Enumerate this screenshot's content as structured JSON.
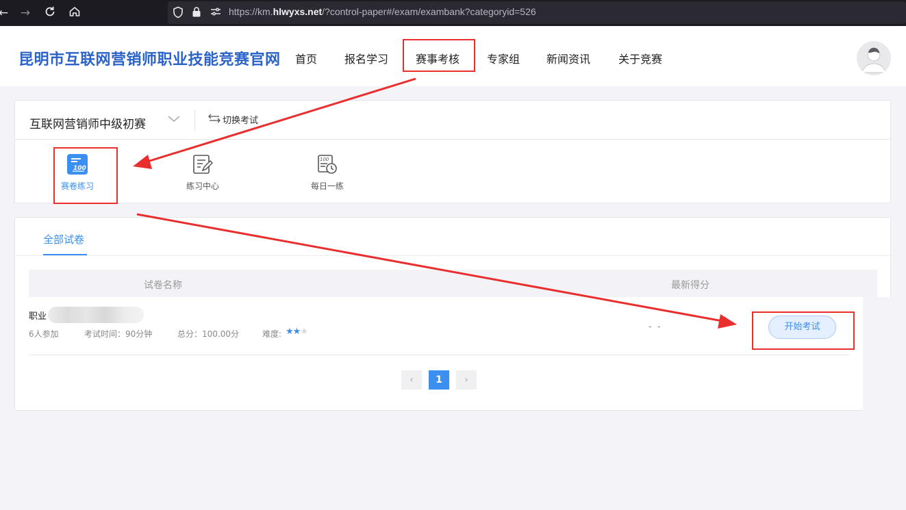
{
  "browser": {
    "back_icon": "back-arrow-icon",
    "forward_icon": "forward-arrow-icon",
    "reload_icon": "reload-icon",
    "home_icon": "home-icon",
    "url_prefix": "https://km.",
    "url_domain": "hlwyxs.net",
    "url_suffix": "/?control-paper#/exam/exambank?categoryid=526"
  },
  "header": {
    "site_title": "昆明市互联网营销师职业技能竞赛官网",
    "nav": [
      {
        "label": "首页"
      },
      {
        "label": "报名学习"
      },
      {
        "label": "赛事考核"
      },
      {
        "label": "专家组"
      },
      {
        "label": "新闻资讯"
      },
      {
        "label": "关于竞赛"
      }
    ]
  },
  "exam_selector": {
    "current_exam": "互联网营销师中级初赛",
    "switch_label": "切换考试",
    "tools": [
      {
        "label": "赛卷练习",
        "icon": "exam-paper-icon"
      },
      {
        "label": "练习中心",
        "icon": "practice-edit-icon"
      },
      {
        "label": "每日一练",
        "icon": "daily-clock-icon"
      }
    ]
  },
  "paper_list": {
    "tab_label": "全部试卷",
    "columns": {
      "name": "试卷名称",
      "score": "最新得分"
    },
    "rows": [
      {
        "title_prefix": "职业",
        "participants": "6人参加",
        "exam_time": "考试时间：90分钟",
        "total_score": "总分：100.00分",
        "difficulty_label": "难度:",
        "difficulty": 2,
        "difficulty_max": 3,
        "latest_score": "- -",
        "action_label": "开始考试"
      }
    ],
    "pagination": {
      "prev": "‹",
      "current": "1",
      "next": "›"
    }
  },
  "colors": {
    "accent": "#3b8ff0",
    "title_blue": "#2b63c9",
    "annotation_red": "#ea2d2d"
  }
}
